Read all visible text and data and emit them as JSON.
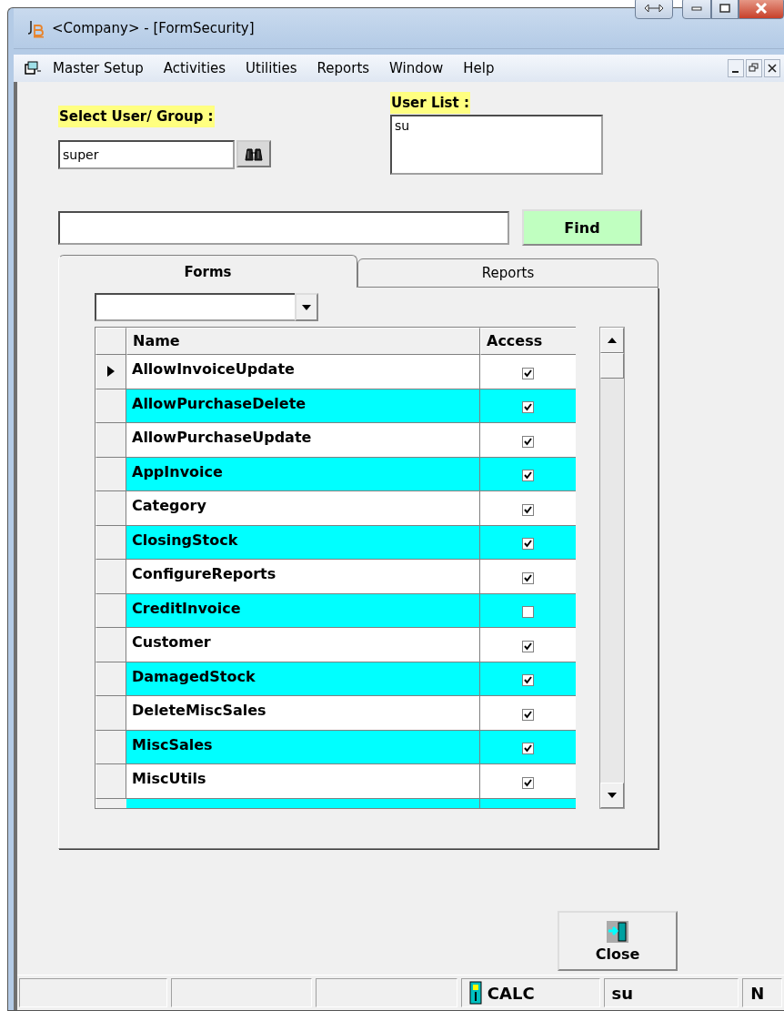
{
  "window": {
    "title": "<Company> - [FormSecurity]"
  },
  "menu": [
    "Master Setup",
    "Activities",
    "Utilities",
    "Reports",
    "Window",
    "Help"
  ],
  "select_user": {
    "label": "Select User/ Group :",
    "value": "super"
  },
  "user_list": {
    "label": "User List :",
    "items": [
      "su"
    ]
  },
  "search": {
    "button": "Find"
  },
  "tabs": [
    {
      "label": "Forms",
      "selected": true
    },
    {
      "label": "Reports",
      "selected": false
    }
  ],
  "grid": {
    "columns": [
      "Name",
      "Access"
    ],
    "rows": [
      {
        "name": "AllowInvoiceUpdate",
        "access": true,
        "current": true
      },
      {
        "name": "AllowPurchaseDelete",
        "access": true,
        "current": false
      },
      {
        "name": "AllowPurchaseUpdate",
        "access": true,
        "current": false
      },
      {
        "name": "AppInvoice",
        "access": true,
        "current": false
      },
      {
        "name": "Category",
        "access": true,
        "current": false
      },
      {
        "name": "ClosingStock",
        "access": true,
        "current": false
      },
      {
        "name": "ConfigureReports",
        "access": true,
        "current": false
      },
      {
        "name": "CreditInvoice",
        "access": false,
        "current": false
      },
      {
        "name": "Customer",
        "access": true,
        "current": false
      },
      {
        "name": "DamagedStock",
        "access": true,
        "current": false
      },
      {
        "name": "DeleteMiscSales",
        "access": true,
        "current": false
      },
      {
        "name": "MiscSales",
        "access": true,
        "current": false
      },
      {
        "name": "MiscUtils",
        "access": true,
        "current": false
      }
    ]
  },
  "close_button": "Close",
  "status_bar": {
    "panels": [
      "CALC",
      "su",
      "N"
    ]
  }
}
